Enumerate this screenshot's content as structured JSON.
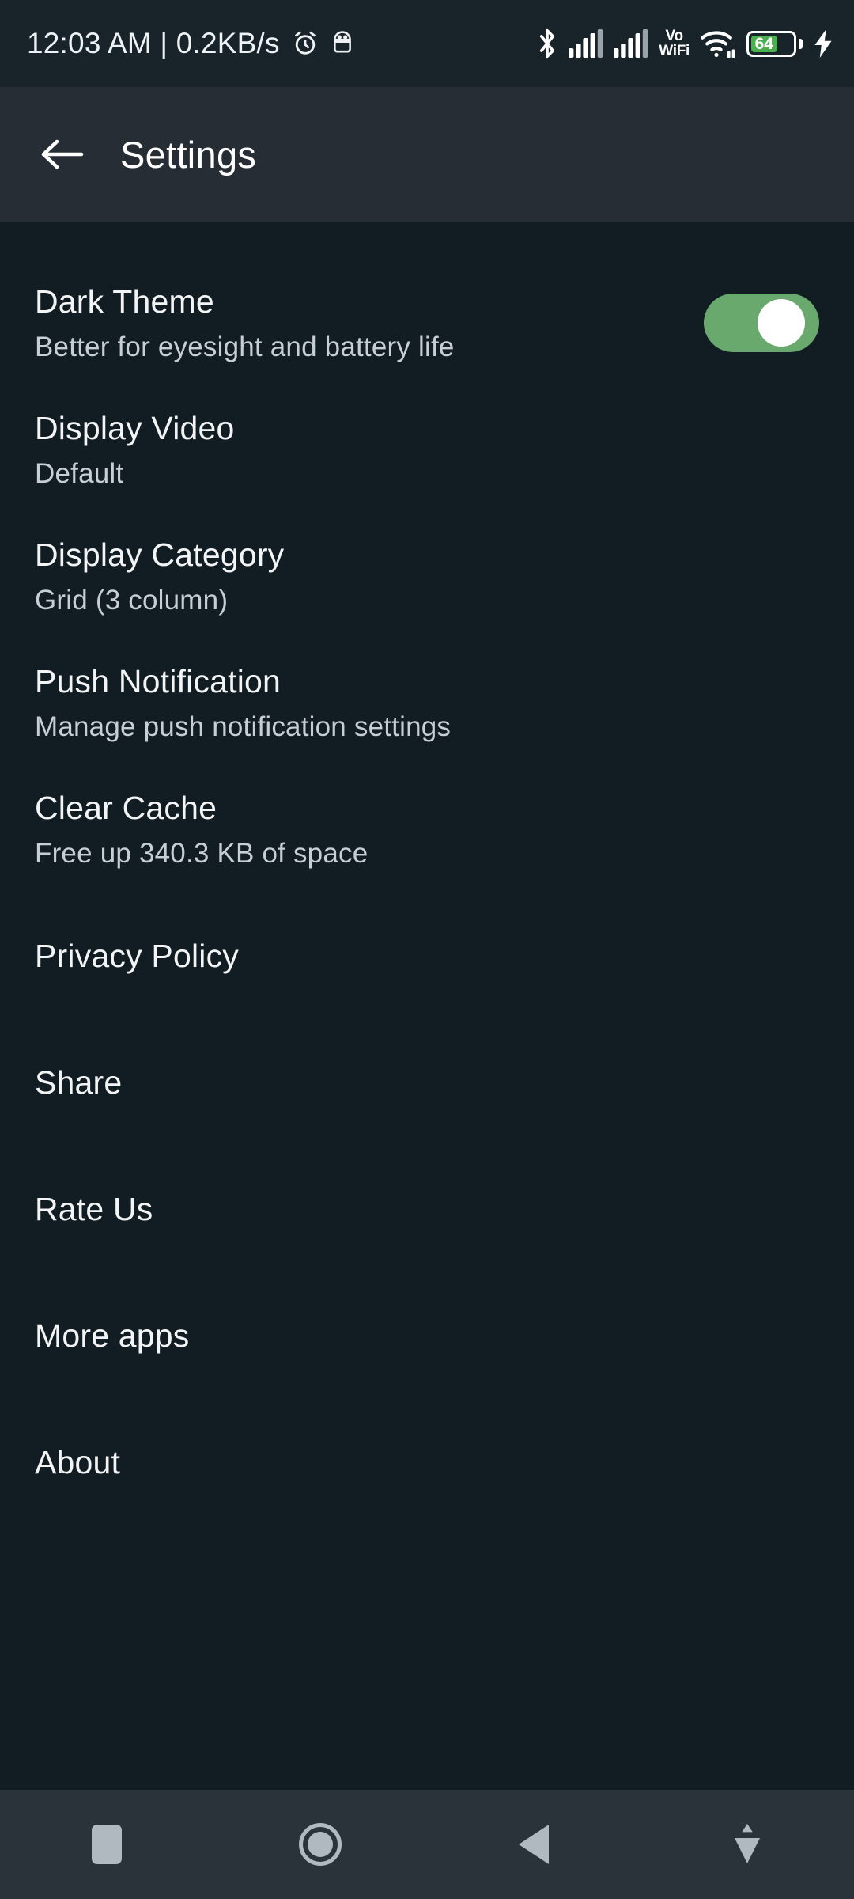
{
  "colors": {
    "status_bar_bg": "#18242a",
    "toolbar_bg": "#262d34",
    "content_bg": "#111d22",
    "nav_bar_bg": "#2b333a",
    "switch_on": "#69a96d",
    "switch_thumb": "#ffffff",
    "battery_fill": "#4caf50",
    "title_text": "#f2f4f6",
    "summary_text": "#c7ced4",
    "nav_icon": "#b0b8c0"
  },
  "status_bar": {
    "clock": "12:03 AM | 0.2KB/s",
    "left_icons": [
      "alarm-icon",
      "android-debug-icon"
    ],
    "right_icons": [
      "bluetooth-icon",
      "signal-sim1-icon",
      "signal-sim2-icon",
      "vowifi-icon",
      "wifi-icon",
      "battery-icon",
      "charging-bolt-icon"
    ],
    "vowifi": {
      "line1": "Vo",
      "line2": "WiFi"
    },
    "battery": {
      "percent": "64",
      "charging": true
    }
  },
  "toolbar": {
    "back_icon": "arrow-left-icon",
    "title": "Settings"
  },
  "settings": {
    "items": [
      {
        "key": "dark-theme",
        "title": "Dark Theme",
        "summary": "Better for eyesight and battery life",
        "control": "switch",
        "checked": true
      },
      {
        "key": "display-video",
        "title": "Display Video",
        "summary": "Default",
        "control": "none"
      },
      {
        "key": "display-category",
        "title": "Display Category",
        "summary": "Grid (3 column)",
        "control": "none"
      },
      {
        "key": "push-notification",
        "title": "Push Notification",
        "summary": "Manage push notification settings",
        "control": "none"
      },
      {
        "key": "clear-cache",
        "title": "Clear Cache",
        "summary": "Free up 340.3 KB of space",
        "control": "none"
      },
      {
        "key": "privacy-policy",
        "title": "Privacy Policy",
        "summary": "",
        "control": "none"
      },
      {
        "key": "share",
        "title": "Share",
        "summary": "",
        "control": "none"
      },
      {
        "key": "rate-us",
        "title": "Rate Us",
        "summary": "",
        "control": "none"
      },
      {
        "key": "more-apps",
        "title": "More apps",
        "summary": "",
        "control": "none"
      },
      {
        "key": "about",
        "title": "About",
        "summary": "",
        "control": "none"
      }
    ]
  },
  "nav_bar": {
    "buttons": [
      "recents-icon",
      "home-icon",
      "back-triangle-icon",
      "hide-keyboard-icon"
    ]
  }
}
